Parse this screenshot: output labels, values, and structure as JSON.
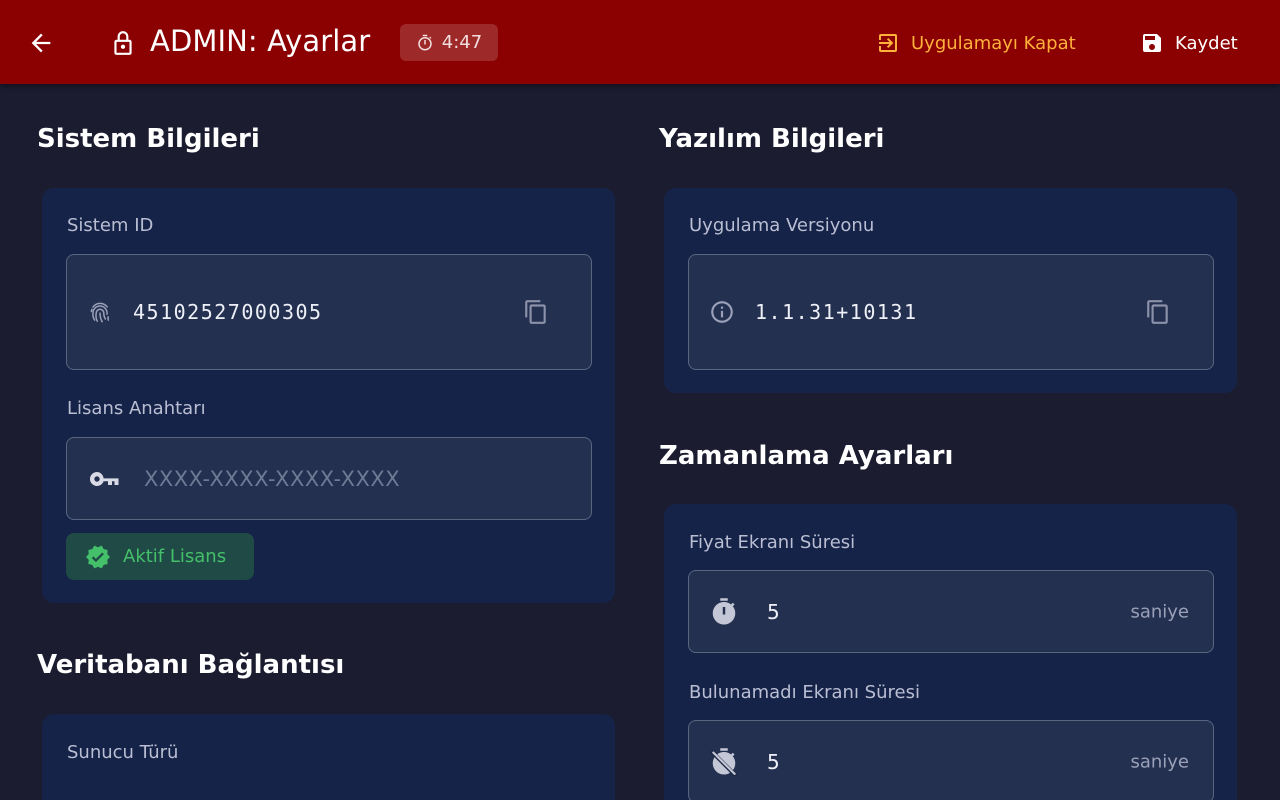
{
  "appbar": {
    "title": "ADMIN: Ayarlar",
    "timer": "4:47",
    "close_app_label": "Uygulamayı Kapat",
    "save_label": "Kaydet"
  },
  "system_info": {
    "title": "Sistem Bilgileri",
    "system_id_label": "Sistem ID",
    "system_id_value": "45102527000305",
    "license_label": "Lisans Anahtarı",
    "license_placeholder": "XXXX-XXXX-XXXX-XXXX",
    "license_status": "Aktif Lisans"
  },
  "database": {
    "title": "Veritabanı Bağlantısı",
    "server_type_label": "Sunucu Türü"
  },
  "software_info": {
    "title": "Yazılım Bilgileri",
    "version_label": "Uygulama Versiyonu",
    "version_value": "1.1.31+10131"
  },
  "timing": {
    "title": "Zamanlama Ayarları",
    "price_screen_label": "Fiyat Ekranı Süresi",
    "price_screen_value": "5",
    "price_screen_unit": "saniye",
    "not_found_label": "Bulunamadı Ekranı Süresi",
    "not_found_value": "5",
    "not_found_unit": "saniye"
  },
  "colors": {
    "appbar": "#8b0000",
    "background": "#1b1c30",
    "card": "#162348",
    "field": "#243050",
    "warning_accent": "#ffb13b",
    "success": "#45c06a"
  },
  "icons": {
    "back": "arrow-left-icon",
    "lock": "lock-icon",
    "timer": "timer-icon",
    "exit": "exit-icon",
    "save": "save-icon",
    "fingerprint": "fingerprint-icon",
    "copy": "copy-icon",
    "key": "key-icon",
    "verified": "verified-icon",
    "info": "info-icon",
    "timer_off": "timer-off-icon"
  }
}
